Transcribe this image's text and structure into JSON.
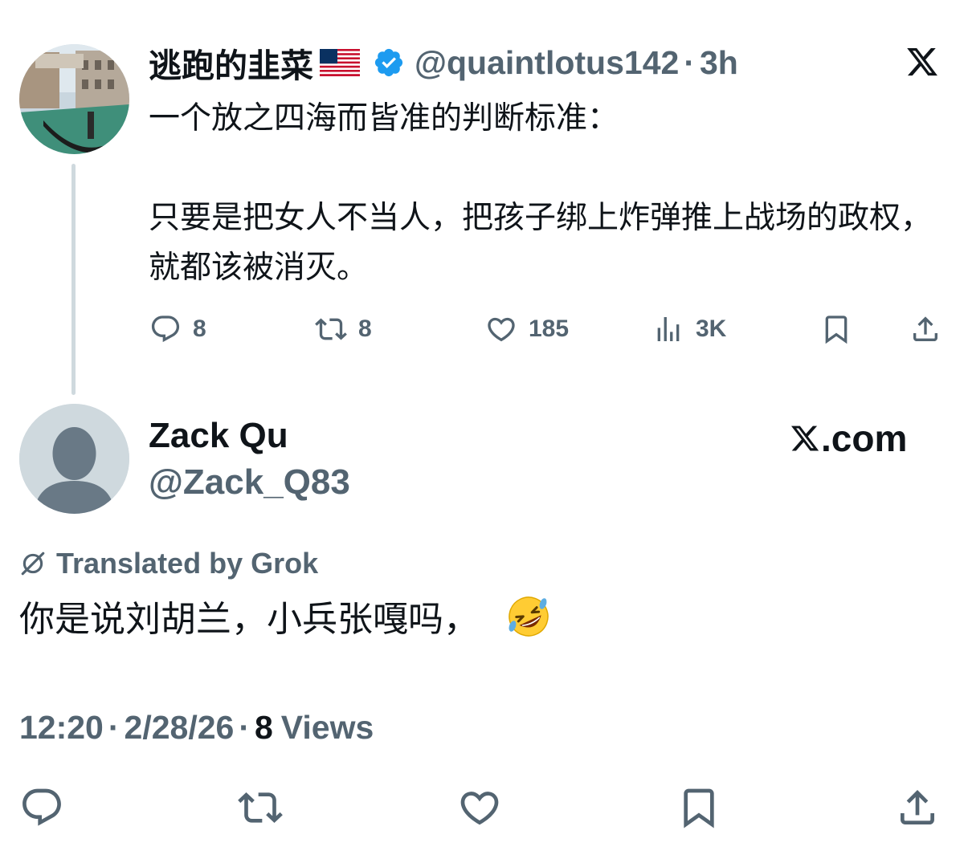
{
  "original_tweet": {
    "author_name": "逃跑的韭菜",
    "handle": "@quaintlotus142",
    "separator": "·",
    "time": "3h",
    "text": "一个放之四海而皆准的判断标准：\n\n只要是把女人不当人，把孩子绑上炸弹推上战场的政权，就都该被消灭。",
    "stats": {
      "replies": "8",
      "reposts": "8",
      "likes": "185",
      "views": "3K"
    }
  },
  "reply": {
    "author_name": "Zack Qu",
    "handle": "@Zack_Q83",
    "brand": "X.com",
    "translation_label": "Translated by Grok",
    "text": "你是说刘胡兰，小兵张嘎吗，",
    "time": "12:20",
    "date": "2/28/26",
    "views_count": "8",
    "views_label": "Views",
    "separator": "·"
  },
  "colors": {
    "primary_text": "#0f1419",
    "secondary_text": "#536471",
    "verified_blue": "#1d9bf0",
    "thread_line": "#cfd9de"
  },
  "icons": [
    "reply-icon",
    "repost-icon",
    "like-icon",
    "views-icon",
    "bookmark-icon",
    "share-icon",
    "verified-icon",
    "x-logo-icon",
    "grok-icon",
    "us-flag-icon",
    "rofl-emoji-icon"
  ]
}
